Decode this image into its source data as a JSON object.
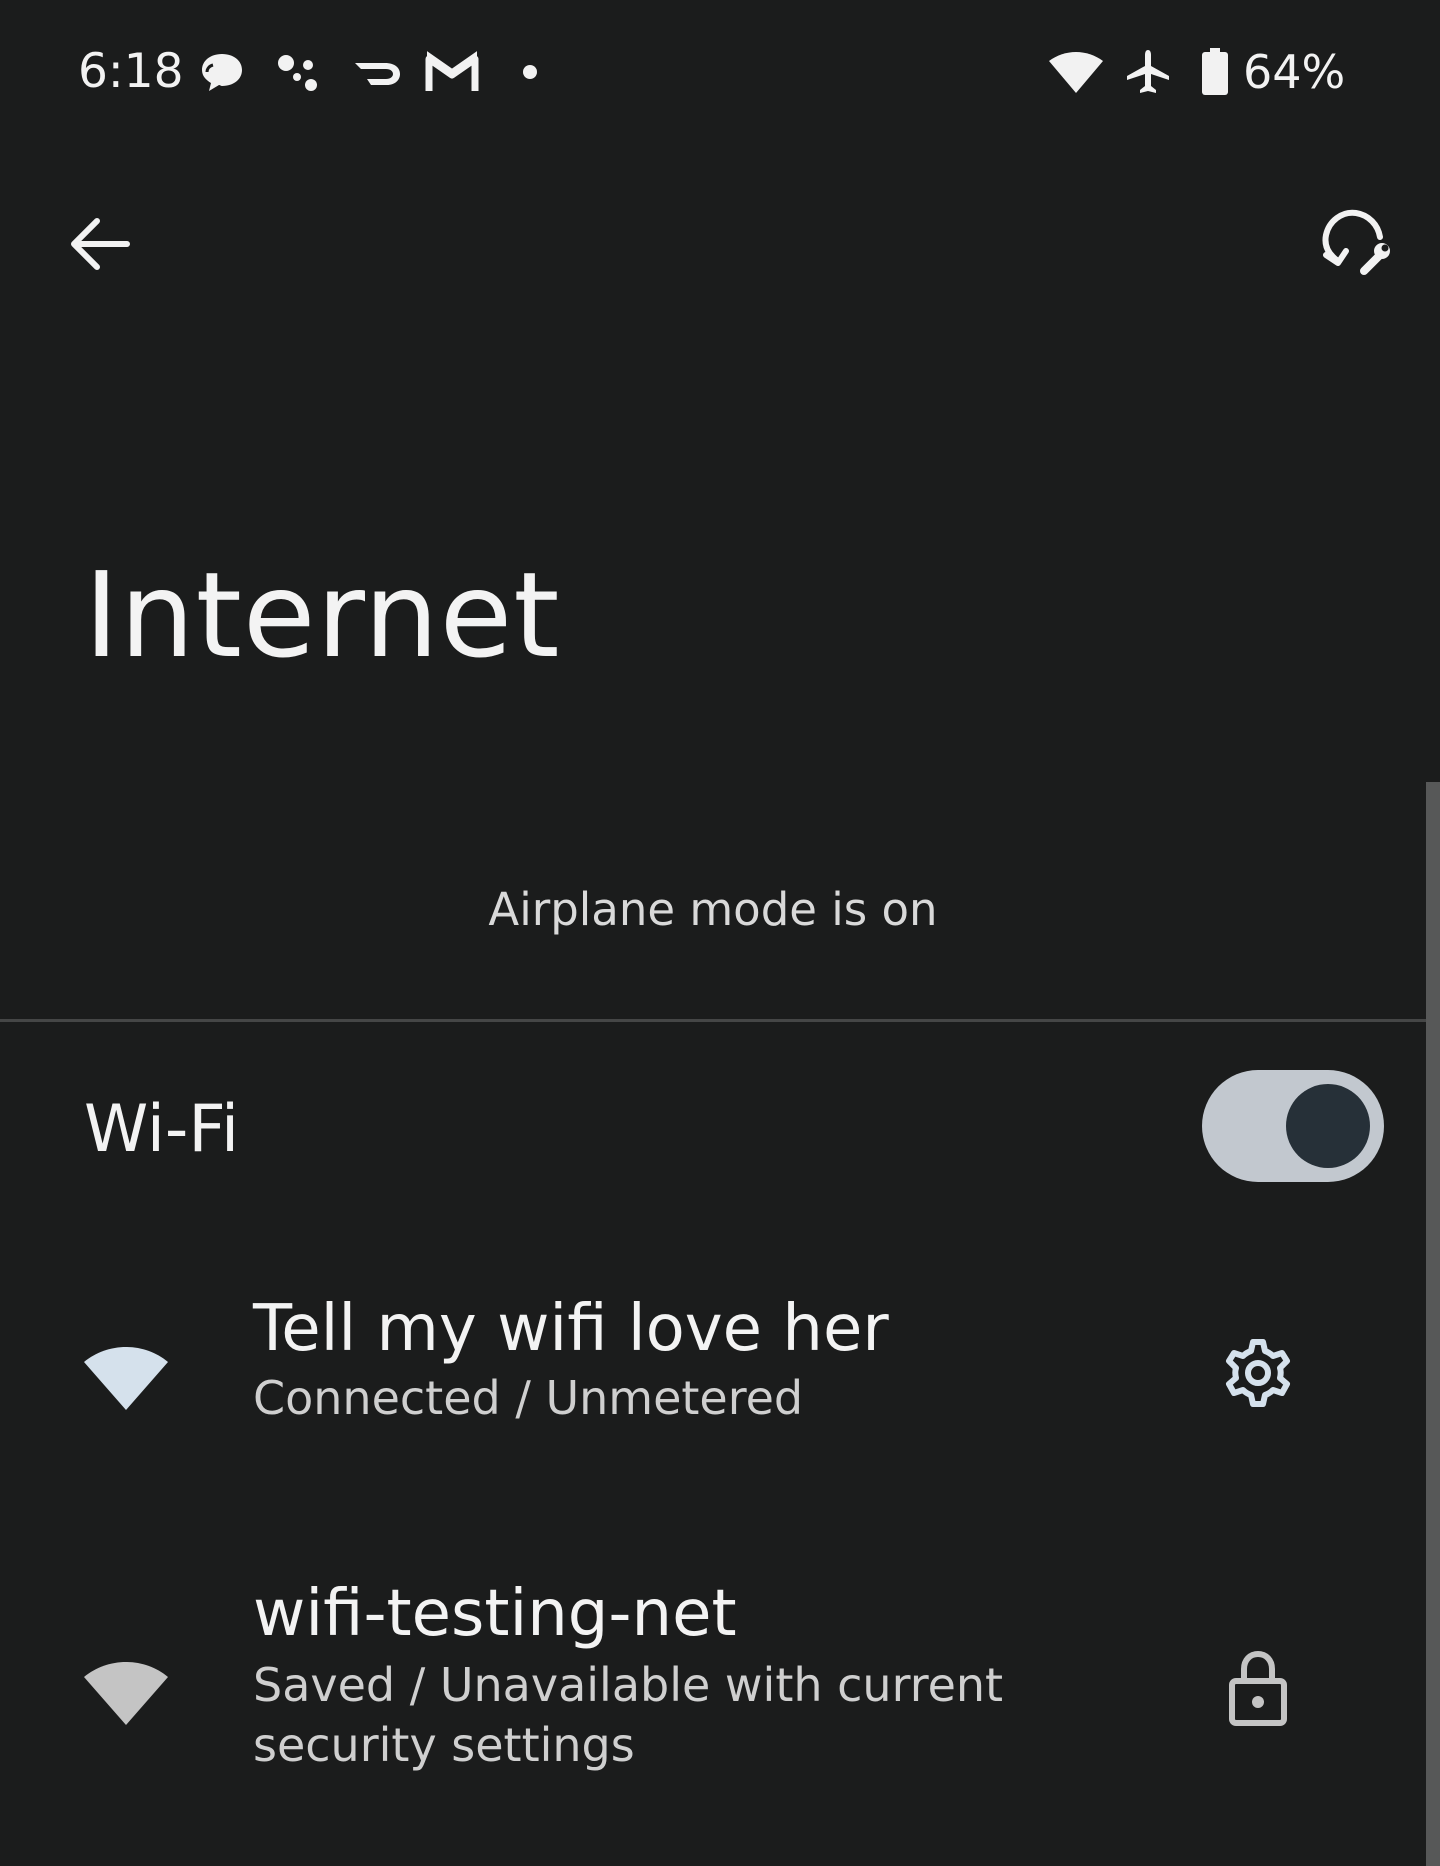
{
  "status_bar": {
    "time": "6:18",
    "notification_icons": [
      "chat-bubble-icon",
      "assistant-dots-icon",
      "doordash-icon",
      "gmail-icon",
      "more-dot-icon"
    ],
    "system_icons": [
      "wifi-icon",
      "airplane-icon",
      "battery-icon"
    ],
    "battery_percent": "64%"
  },
  "app_bar": {
    "back_icon": "arrow-back-icon",
    "action_icon": "network-reset-icon"
  },
  "page": {
    "title": "Internet",
    "airplane_notice": "Airplane mode is on"
  },
  "wifi": {
    "label": "Wi-Fi",
    "enabled": true
  },
  "networks": [
    {
      "name": "Tell my wifi love her",
      "status": "Connected / Unmetered",
      "signal_icon": "wifi-signal-icon",
      "signal_color": "#d5e1ec",
      "action_icon": "gear-icon"
    },
    {
      "name": "wifi-testing-net",
      "status": "Saved / Unavailable with current security settings",
      "signal_icon": "wifi-signal-icon",
      "signal_color": "#c4c4c4",
      "action_icon": "lock-icon"
    }
  ],
  "colors": {
    "background": "#1b1c1c",
    "toggle_track": "#c2c8cf",
    "toggle_knob": "#263038"
  }
}
